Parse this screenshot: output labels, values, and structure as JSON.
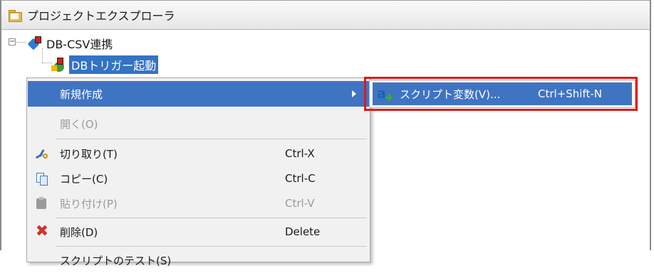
{
  "window": {
    "title": "プロジェクトエクスプローラ"
  },
  "tree": {
    "root": {
      "label": "DB-CSV連携"
    },
    "child": {
      "label": "DBトリガー起動"
    }
  },
  "context_menu": {
    "items": [
      {
        "label": "新規作成",
        "shortcut": ""
      },
      {
        "label": "開く(O)",
        "shortcut": ""
      },
      {
        "label": "切り取り(T)",
        "shortcut": "Ctrl-X"
      },
      {
        "label": "コピー(C)",
        "shortcut": "Ctrl-C"
      },
      {
        "label": "貼り付け(P)",
        "shortcut": "Ctrl-V"
      },
      {
        "label": "削除(D)",
        "shortcut": "Delete"
      },
      {
        "label": "スクリプトのテスト(S)",
        "shortcut": ""
      }
    ]
  },
  "submenu": {
    "item": {
      "label": "スクリプト変数(V)...",
      "shortcut": "Ctrl+Shift-N"
    }
  },
  "colors": {
    "highlight": "#3f74c2",
    "annotation_frame": "#e01818"
  }
}
